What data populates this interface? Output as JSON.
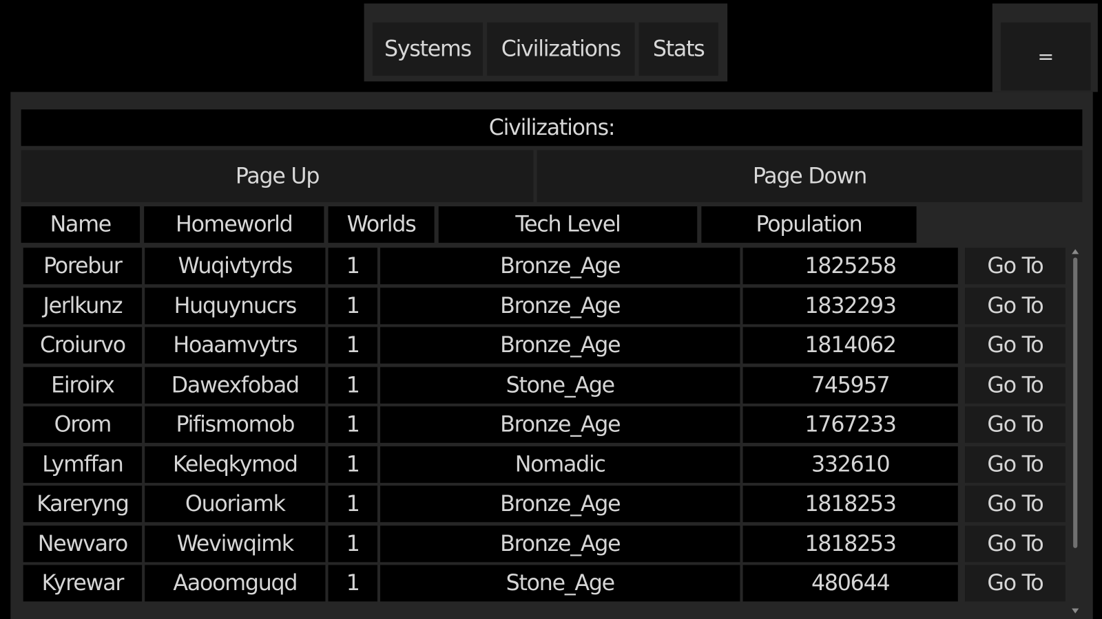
{
  "tabs": [
    {
      "label": "Systems"
    },
    {
      "label": "Civilizations"
    },
    {
      "label": "Stats"
    }
  ],
  "menu_button": {
    "label": "="
  },
  "panel": {
    "title": "Civilizations:",
    "page_up": "Page Up",
    "page_down": "Page Down"
  },
  "columns": [
    "Name",
    "Homeworld",
    "Worlds",
    "Tech Level",
    "Population"
  ],
  "go_to_label": "Go To",
  "rows": [
    {
      "name": "Porebur",
      "homeworld": "Wuqivtyrds",
      "worlds": "1",
      "tech": "Bronze_Age",
      "population": "1825258"
    },
    {
      "name": "Jerlkunz",
      "homeworld": "Huquynucrs",
      "worlds": "1",
      "tech": "Bronze_Age",
      "population": "1832293"
    },
    {
      "name": "Croiurvo",
      "homeworld": "Hoaamvytrs",
      "worlds": "1",
      "tech": "Bronze_Age",
      "population": "1814062"
    },
    {
      "name": "Eiroirx",
      "homeworld": "Dawexfobad",
      "worlds": "1",
      "tech": "Stone_Age",
      "population": "745957"
    },
    {
      "name": "Orom",
      "homeworld": "Pifismomob",
      "worlds": "1",
      "tech": "Bronze_Age",
      "population": "1767233"
    },
    {
      "name": "Lymffan",
      "homeworld": "Keleqkymod",
      "worlds": "1",
      "tech": "Nomadic",
      "population": "332610"
    },
    {
      "name": "Kareryng",
      "homeworld": "Ouoriamk",
      "worlds": "1",
      "tech": "Bronze_Age",
      "population": "1818253"
    },
    {
      "name": "Newvaro",
      "homeworld": "Weviwqimk",
      "worlds": "1",
      "tech": "Bronze_Age",
      "population": "1818253"
    },
    {
      "name": "Kyrewar",
      "homeworld": "Aaoomguqd",
      "worlds": "1",
      "tech": "Stone_Age",
      "population": "480644"
    }
  ]
}
